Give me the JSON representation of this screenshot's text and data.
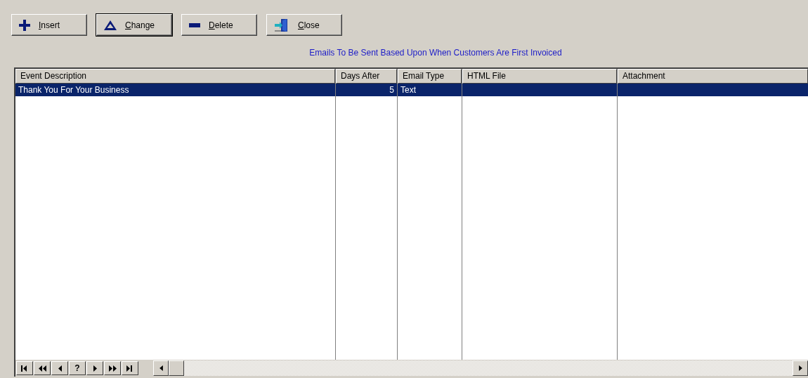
{
  "toolbar": [
    {
      "kind": "insert",
      "accel": "I",
      "rest": "nsert",
      "focused": false
    },
    {
      "kind": "change",
      "accel": "C",
      "rest": "hange",
      "focused": true
    },
    {
      "kind": "delete",
      "accel": "D",
      "rest": "elete",
      "focused": false
    },
    {
      "kind": "close",
      "accel": "C",
      "rest": "lose",
      "focused": false
    }
  ],
  "heading": "Emails To Be Sent Based Upon When Customers Are First Invoiced",
  "table": {
    "columns": [
      {
        "label": "Event Description",
        "kind": "text"
      },
      {
        "label": "Days After",
        "kind": "number"
      },
      {
        "label": "Email Type",
        "kind": "text"
      },
      {
        "label": "HTML File",
        "kind": "text"
      },
      {
        "label": "Attachment",
        "kind": "text"
      }
    ],
    "rows": [
      {
        "selected": true,
        "cells": [
          "Thank You For Your Business",
          "5",
          "Text",
          "",
          ""
        ]
      }
    ]
  },
  "navigator": [
    {
      "kind": "first"
    },
    {
      "kind": "prior-page"
    },
    {
      "kind": "prior"
    },
    {
      "kind": "text",
      "label": "?"
    },
    {
      "kind": "next"
    },
    {
      "kind": "next-page"
    },
    {
      "kind": "last"
    }
  ]
}
